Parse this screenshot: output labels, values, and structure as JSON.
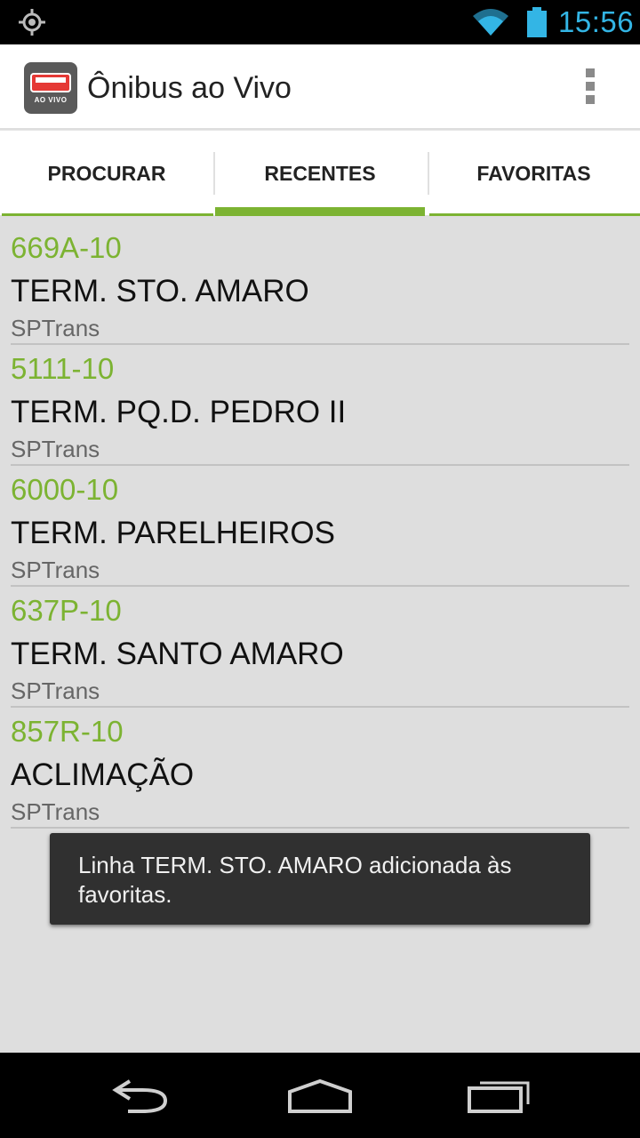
{
  "status_bar": {
    "time": "15:56",
    "accent_color": "#33b5e5",
    "icons": [
      "gps-icon",
      "wifi-icon",
      "battery-icon"
    ]
  },
  "action_bar": {
    "title": "Ônibus ao Vivo",
    "logo_text": "AO VIVO",
    "overflow_icon": "overflow-menu-icon"
  },
  "tabs": [
    {
      "label": "PROCURAR",
      "selected": false
    },
    {
      "label": "RECENTES",
      "selected": true
    },
    {
      "label": "FAVORITAS",
      "selected": false
    }
  ],
  "colors": {
    "accent_green": "#7cb332",
    "background": "#dedede",
    "toast_bg": "#303030"
  },
  "list": {
    "items": [
      {
        "code": "669A-10",
        "name": "TERM. STO. AMARO",
        "operator": "SPTrans"
      },
      {
        "code": "5111-10",
        "name": "TERM. PQ.D. PEDRO II",
        "operator": "SPTrans"
      },
      {
        "code": "6000-10",
        "name": "TERM. PARELHEIROS",
        "operator": "SPTrans"
      },
      {
        "code": "637P-10",
        "name": "TERM. SANTO AMARO",
        "operator": "SPTrans"
      },
      {
        "code": "857R-10",
        "name": "ACLIMAÇÃO",
        "operator": "SPTrans"
      }
    ]
  },
  "toast": {
    "message": "Linha TERM. STO. AMARO adicionada às favoritas."
  },
  "nav_bar": {
    "icons": [
      "back-icon",
      "home-icon",
      "recent-apps-icon"
    ]
  }
}
